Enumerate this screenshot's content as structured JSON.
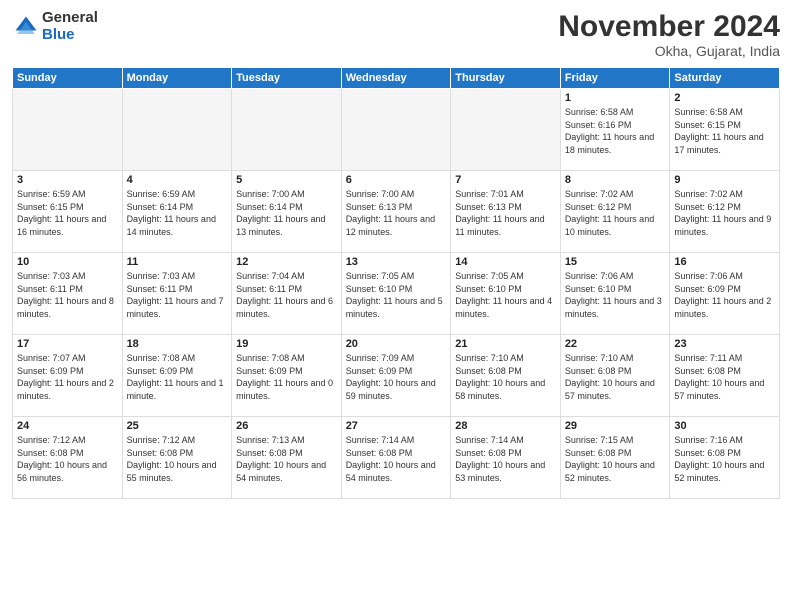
{
  "header": {
    "logo_general": "General",
    "logo_blue": "Blue",
    "title": "November 2024",
    "location": "Okha, Gujarat, India"
  },
  "days_of_week": [
    "Sunday",
    "Monday",
    "Tuesday",
    "Wednesday",
    "Thursday",
    "Friday",
    "Saturday"
  ],
  "weeks": [
    [
      {
        "day": "",
        "info": ""
      },
      {
        "day": "",
        "info": ""
      },
      {
        "day": "",
        "info": ""
      },
      {
        "day": "",
        "info": ""
      },
      {
        "day": "",
        "info": ""
      },
      {
        "day": "1",
        "info": "Sunrise: 6:58 AM\nSunset: 6:16 PM\nDaylight: 11 hours and 18 minutes."
      },
      {
        "day": "2",
        "info": "Sunrise: 6:58 AM\nSunset: 6:15 PM\nDaylight: 11 hours and 17 minutes."
      }
    ],
    [
      {
        "day": "3",
        "info": "Sunrise: 6:59 AM\nSunset: 6:15 PM\nDaylight: 11 hours and 16 minutes."
      },
      {
        "day": "4",
        "info": "Sunrise: 6:59 AM\nSunset: 6:14 PM\nDaylight: 11 hours and 14 minutes."
      },
      {
        "day": "5",
        "info": "Sunrise: 7:00 AM\nSunset: 6:14 PM\nDaylight: 11 hours and 13 minutes."
      },
      {
        "day": "6",
        "info": "Sunrise: 7:00 AM\nSunset: 6:13 PM\nDaylight: 11 hours and 12 minutes."
      },
      {
        "day": "7",
        "info": "Sunrise: 7:01 AM\nSunset: 6:13 PM\nDaylight: 11 hours and 11 minutes."
      },
      {
        "day": "8",
        "info": "Sunrise: 7:02 AM\nSunset: 6:12 PM\nDaylight: 11 hours and 10 minutes."
      },
      {
        "day": "9",
        "info": "Sunrise: 7:02 AM\nSunset: 6:12 PM\nDaylight: 11 hours and 9 minutes."
      }
    ],
    [
      {
        "day": "10",
        "info": "Sunrise: 7:03 AM\nSunset: 6:11 PM\nDaylight: 11 hours and 8 minutes."
      },
      {
        "day": "11",
        "info": "Sunrise: 7:03 AM\nSunset: 6:11 PM\nDaylight: 11 hours and 7 minutes."
      },
      {
        "day": "12",
        "info": "Sunrise: 7:04 AM\nSunset: 6:11 PM\nDaylight: 11 hours and 6 minutes."
      },
      {
        "day": "13",
        "info": "Sunrise: 7:05 AM\nSunset: 6:10 PM\nDaylight: 11 hours and 5 minutes."
      },
      {
        "day": "14",
        "info": "Sunrise: 7:05 AM\nSunset: 6:10 PM\nDaylight: 11 hours and 4 minutes."
      },
      {
        "day": "15",
        "info": "Sunrise: 7:06 AM\nSunset: 6:10 PM\nDaylight: 11 hours and 3 minutes."
      },
      {
        "day": "16",
        "info": "Sunrise: 7:06 AM\nSunset: 6:09 PM\nDaylight: 11 hours and 2 minutes."
      }
    ],
    [
      {
        "day": "17",
        "info": "Sunrise: 7:07 AM\nSunset: 6:09 PM\nDaylight: 11 hours and 2 minutes."
      },
      {
        "day": "18",
        "info": "Sunrise: 7:08 AM\nSunset: 6:09 PM\nDaylight: 11 hours and 1 minute."
      },
      {
        "day": "19",
        "info": "Sunrise: 7:08 AM\nSunset: 6:09 PM\nDaylight: 11 hours and 0 minutes."
      },
      {
        "day": "20",
        "info": "Sunrise: 7:09 AM\nSunset: 6:09 PM\nDaylight: 10 hours and 59 minutes."
      },
      {
        "day": "21",
        "info": "Sunrise: 7:10 AM\nSunset: 6:08 PM\nDaylight: 10 hours and 58 minutes."
      },
      {
        "day": "22",
        "info": "Sunrise: 7:10 AM\nSunset: 6:08 PM\nDaylight: 10 hours and 57 minutes."
      },
      {
        "day": "23",
        "info": "Sunrise: 7:11 AM\nSunset: 6:08 PM\nDaylight: 10 hours and 57 minutes."
      }
    ],
    [
      {
        "day": "24",
        "info": "Sunrise: 7:12 AM\nSunset: 6:08 PM\nDaylight: 10 hours and 56 minutes."
      },
      {
        "day": "25",
        "info": "Sunrise: 7:12 AM\nSunset: 6:08 PM\nDaylight: 10 hours and 55 minutes."
      },
      {
        "day": "26",
        "info": "Sunrise: 7:13 AM\nSunset: 6:08 PM\nDaylight: 10 hours and 54 minutes."
      },
      {
        "day": "27",
        "info": "Sunrise: 7:14 AM\nSunset: 6:08 PM\nDaylight: 10 hours and 54 minutes."
      },
      {
        "day": "28",
        "info": "Sunrise: 7:14 AM\nSunset: 6:08 PM\nDaylight: 10 hours and 53 minutes."
      },
      {
        "day": "29",
        "info": "Sunrise: 7:15 AM\nSunset: 6:08 PM\nDaylight: 10 hours and 52 minutes."
      },
      {
        "day": "30",
        "info": "Sunrise: 7:16 AM\nSunset: 6:08 PM\nDaylight: 10 hours and 52 minutes."
      }
    ]
  ]
}
